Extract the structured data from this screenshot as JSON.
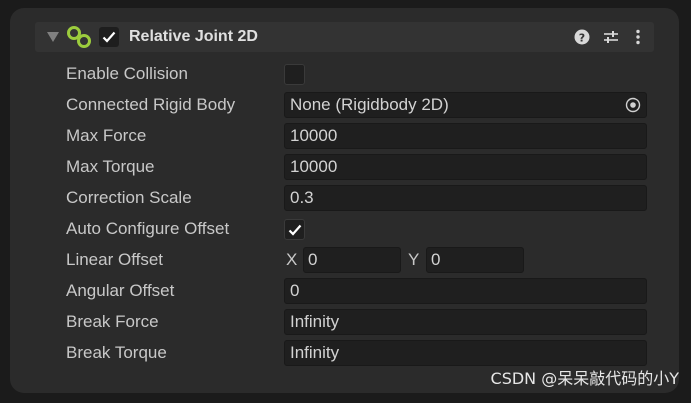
{
  "component": {
    "title": "Relative Joint 2D",
    "enabled": true,
    "icons": {
      "foldout": "triangle-down-icon",
      "component": "relative-joint-2d-icon",
      "help": "question-mark-circle-icon",
      "presets": "sliders-icon",
      "menu": "kebab-menu-icon"
    }
  },
  "properties": {
    "enable_collision": {
      "label": "Enable Collision",
      "checked": false
    },
    "connected_rigid_body": {
      "label": "Connected Rigid Body",
      "value": "None (Rigidbody 2D)",
      "icon": "object-picker-icon"
    },
    "max_force": {
      "label": "Max Force",
      "value": "10000"
    },
    "max_torque": {
      "label": "Max Torque",
      "value": "10000"
    },
    "correction_scale": {
      "label": "Correction Scale",
      "value": "0.3"
    },
    "auto_configure_offset": {
      "label": "Auto Configure Offset",
      "checked": true
    },
    "linear_offset": {
      "label": "Linear Offset",
      "x_label": "X",
      "x": "0",
      "y_label": "Y",
      "y": "0"
    },
    "angular_offset": {
      "label": "Angular Offset",
      "value": "0"
    },
    "break_force": {
      "label": "Break Force",
      "value": "Infinity"
    },
    "break_torque": {
      "label": "Break Torque",
      "value": "Infinity"
    }
  },
  "watermark": "CSDN @呆呆敲代码的小Y",
  "colors": {
    "panel_bg": "#2b2b2b",
    "header_bg": "#333333",
    "field_bg": "#1f1f1f",
    "label_text": "#c8c8c8",
    "icon_green": "#9ccc3d"
  }
}
